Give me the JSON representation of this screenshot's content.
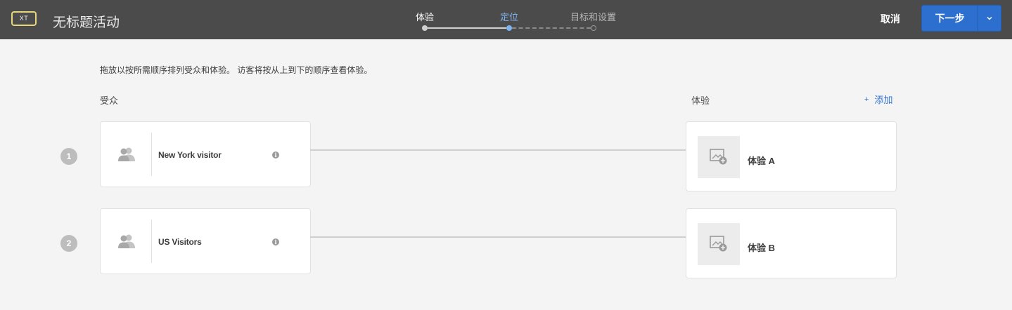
{
  "header": {
    "badge": "XT",
    "title": "无标题活动",
    "steps": [
      {
        "label": "体验",
        "state": "done"
      },
      {
        "label": "定位",
        "state": "active"
      },
      {
        "label": "目标和设置",
        "state": "pending"
      }
    ],
    "cancel_label": "取消",
    "next_label": "下一步"
  },
  "main": {
    "instruction": "拖放以按所需顺序排列受众和体验。 访客将按从上到下的顺序查看体验。",
    "audience_heading": "受众",
    "experience_heading": "体验",
    "add_icon": "+",
    "add_label": "添加",
    "rows": [
      {
        "number": "1",
        "audience": "New York visitor",
        "info_icon": "i",
        "experience": "体验 A"
      },
      {
        "number": "2",
        "audience": "US Visitors",
        "info_icon": "i",
        "experience": "体验 B"
      }
    ]
  },
  "icons": {
    "badge": "xt-badge-icon",
    "audience": "users-icon",
    "info": "info-icon",
    "experience": "add-image-icon",
    "dropdown": "chevron-down-icon"
  },
  "colors": {
    "header_bg": "#4b4b4b",
    "page_bg": "#f4f4f4",
    "accent": "#2d6fcf",
    "active_step": "#7fb3f0",
    "badge_border": "#e6d77a"
  }
}
